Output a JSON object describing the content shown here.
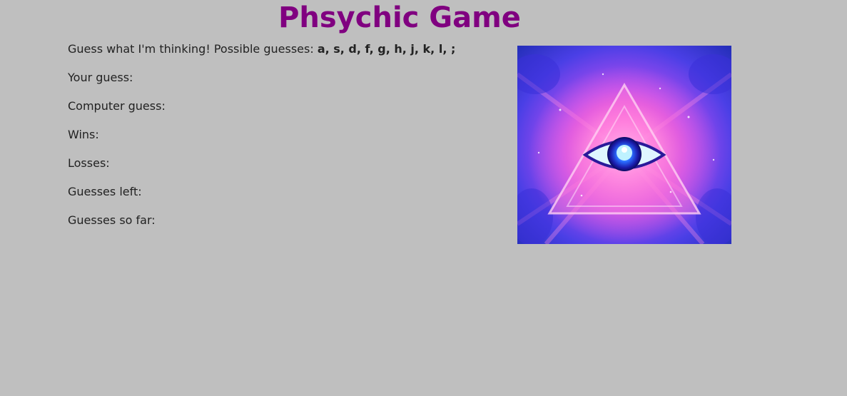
{
  "title": "Phsychic Game",
  "instructions": {
    "prefix": "Guess what I'm thinking! Possible guesses: ",
    "keys": "a, s, d, f, g, h, j, k, l, ;"
  },
  "stats": [
    {
      "label": "Your guess:",
      "value": ""
    },
    {
      "label": "Computer guess:",
      "value": ""
    },
    {
      "label": "Wins:",
      "value": ""
    },
    {
      "label": "Losses:",
      "value": ""
    },
    {
      "label": "Guesses left:",
      "value": ""
    },
    {
      "label": "Guesses so far:",
      "value": ""
    }
  ],
  "image": {
    "icon": "all-seeing-eye-image"
  },
  "colors": {
    "background": "#bfbfbf",
    "title": "#800080",
    "text": "#222222"
  }
}
